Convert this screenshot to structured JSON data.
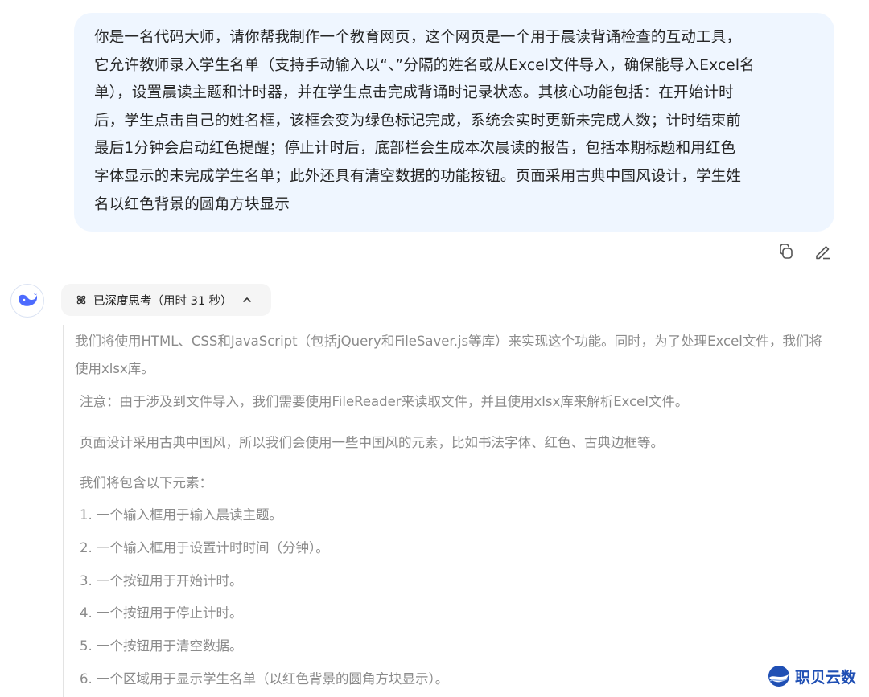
{
  "user_message": {
    "lines": [
      "你是一名代码大师，请你帮我制作一个教育网页，这个网页是一个用于晨读背诵检查的互动工具，",
      "它允许教师录入学生名单（支持手动输入以“、”分隔的姓名或从Excel文件导入，确保能导入Excel名",
      "单），设置晨读主题和计时器，并在学生点击完成背诵时记录状态。其核心功能包括：在开始计时",
      "后，学生点击自己的姓名框，该框会变为绿色标记完成，系统会实时更新未完成人数；计时结束前",
      "最后1分钟会启动红色提醒；停止计时后，底部栏会生成本次晨读的报告，包括本期标题和用红色",
      "字体显示的未完成学生名单；此外还具有清空数据的功能按钮。页面采用古典中国风设计，学生姓",
      "名以红色背景的圆角方块显示"
    ]
  },
  "actions": {
    "copy_icon": "copy-icon",
    "edit_icon": "edit-icon"
  },
  "thinking": {
    "toggle_label": "已深度思考（用时 31 秒）",
    "paragraphs": [
      "我们将使用HTML、CSS和JavaScript（包括jQuery和FileSaver.js等库）来实现这个功能。同时，为了处理Excel文件，我们将使用xlsx库。",
      "注意：由于涉及到文件导入，我们需要使用FileReader来读取文件，并且使用xlsx库来解析Excel文件。",
      "页面设计采用古典中国风，所以我们会使用一些中国风的元素，比如书法字体、红色、古典边框等。",
      "我们将包含以下元素：",
      "1. 一个输入框用于输入晨读主题。",
      "2. 一个输入框用于设置计时时间（分钟）。",
      "3. 一个按钮用于开始计时。",
      "4. 一个按钮用于停止计时。",
      "5. 一个按钮用于清空数据。",
      "6. 一个区域用于显示学生名单（以红色背景的圆角方块显示）。"
    ]
  },
  "watermark": {
    "text": "职贝云数"
  },
  "colors": {
    "bubble_bg": "#eff6ff",
    "accent_blue": "#4d6bfe",
    "thinking_text": "#8b8b8b"
  }
}
